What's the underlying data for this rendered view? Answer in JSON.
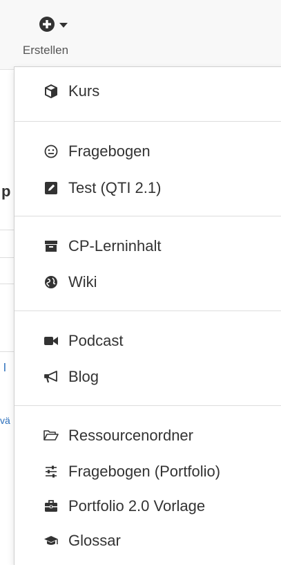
{
  "header": {
    "create_label": "Erstellen",
    "create_icon": "plus-circle-icon",
    "caret_icon": "caret-down-icon"
  },
  "background": {
    "frag_p": "p",
    "frag_l": "l",
    "frag_va": "vä"
  },
  "menu": {
    "groups": [
      [
        {
          "label": "Kurs",
          "icon": "cube-icon"
        }
      ],
      [
        {
          "label": "Fragebogen",
          "icon": "smile-icon"
        },
        {
          "label": "Test (QTI 2.1)",
          "icon": "edit-icon"
        }
      ],
      [
        {
          "label": "CP-Lerninhalt",
          "icon": "archive-icon"
        },
        {
          "label": "Wiki",
          "icon": "globe-icon"
        }
      ],
      [
        {
          "label": "Podcast",
          "icon": "video-camera-icon"
        },
        {
          "label": "Blog",
          "icon": "bullhorn-icon"
        }
      ],
      [
        {
          "label": "Ressourcenordner",
          "icon": "folder-open-icon"
        },
        {
          "label": "Fragebogen (Portfolio)",
          "icon": "sliders-icon"
        },
        {
          "label": "Portfolio 2.0 Vorlage",
          "icon": "briefcase-icon"
        },
        {
          "label": "Glossar",
          "icon": "graduation-cap-icon"
        }
      ]
    ]
  }
}
